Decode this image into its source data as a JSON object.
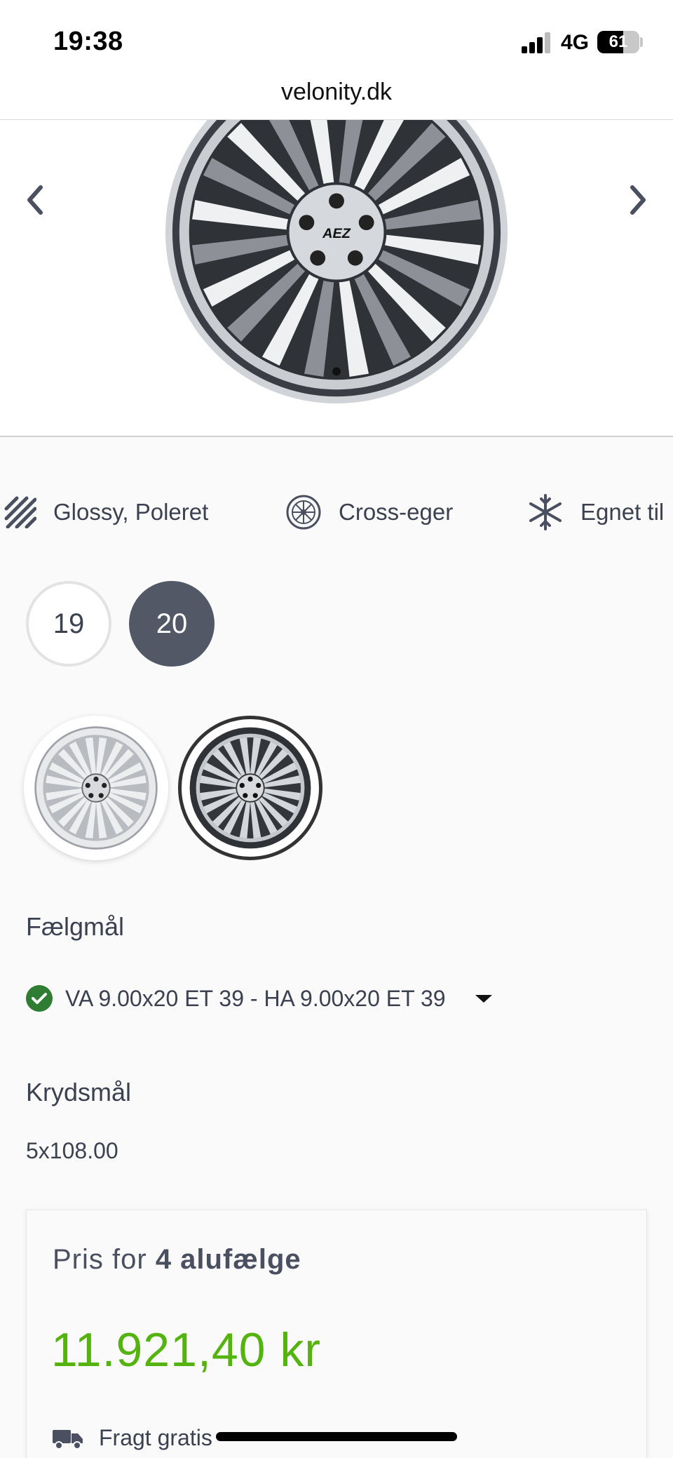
{
  "status_bar": {
    "time": "19:38",
    "network": "4G",
    "battery_level": "61",
    "battery_fraction": 0.61
  },
  "browser": {
    "url": "velonity.dk"
  },
  "gallery": {
    "prev_icon": "chevron-left-icon",
    "next_icon": "chevron-right-icon",
    "image": "wheel-rim-image",
    "brand_text": "AEZ"
  },
  "features": [
    {
      "icon": "diagonal-stripes-icon",
      "label": "Glossy, Poleret"
    },
    {
      "icon": "cross-spoke-wheel-icon",
      "label": "Cross-eger"
    },
    {
      "icon": "snowflake-icon",
      "label": "Egnet til"
    }
  ],
  "sizes": {
    "options": [
      "19",
      "20"
    ],
    "selected": "20"
  },
  "colors": {
    "options": [
      "silver",
      "dark"
    ],
    "selected": "dark"
  },
  "rim_dimensions": {
    "label": "Fælgmål",
    "selected_value": "VA 9.00x20 ET 39 - HA 9.00x20 ET 39",
    "status_icon": "check-circle-icon"
  },
  "bolt_pattern": {
    "label": "Krydsmål",
    "value": "5x108.00"
  },
  "price_card": {
    "heading_prefix": "Pris for",
    "heading_bold": "4 alufælge",
    "amount": "11.921,40 kr",
    "shipping_label": "Fragt gratis",
    "shipping_icon": "truck-icon"
  },
  "colors_theme": {
    "accent_dark": "#525866",
    "price_green": "#55b30f",
    "check_green": "#2e7d32"
  }
}
